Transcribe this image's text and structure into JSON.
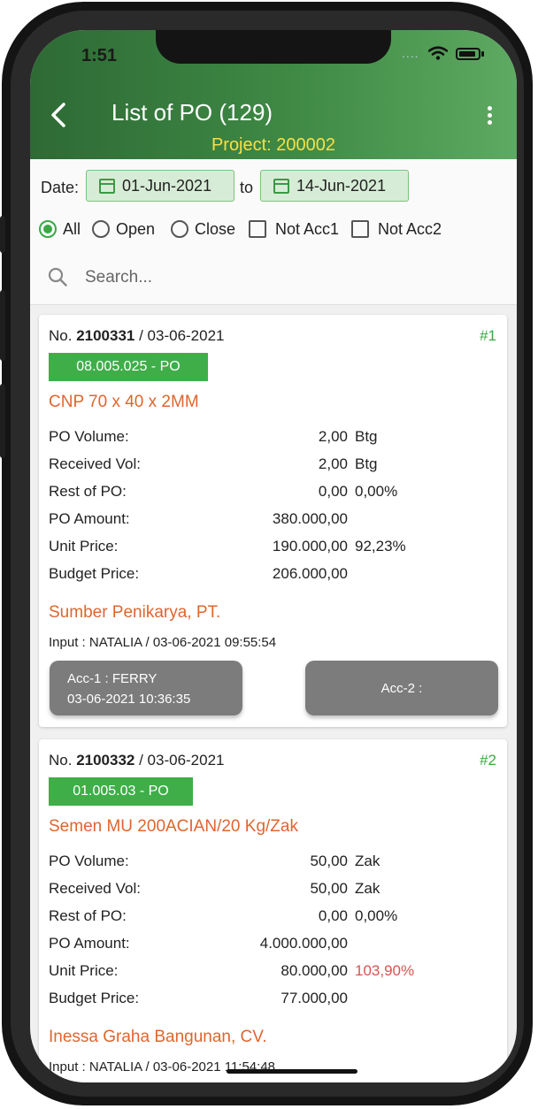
{
  "status_bar": {
    "time": "1:51",
    "dots": "...."
  },
  "header": {
    "title": "List of PO (129)",
    "subtitle": "Project: 200002"
  },
  "filters": {
    "date_label": "Date:",
    "date_from": "01-Jun-2021",
    "to_label": "to",
    "date_to": "14-Jun-2021",
    "options": [
      {
        "label": "All",
        "kind": "radio",
        "checked": true
      },
      {
        "label": "Open",
        "kind": "radio",
        "checked": false
      },
      {
        "label": "Close",
        "kind": "radio",
        "checked": false
      },
      {
        "label": "Not Acc1",
        "kind": "checkbox",
        "checked": false
      },
      {
        "label": "Not Acc2",
        "kind": "checkbox",
        "checked": false
      }
    ]
  },
  "search": {
    "placeholder": "Search..."
  },
  "cards": [
    {
      "no_prefix": "No. ",
      "po_number": "2100331",
      "po_date": " / 03-06-2021",
      "index": "#1",
      "code": "08.005.025 - PO",
      "item": "CNP 70 x 40 x 2MM",
      "rows": [
        {
          "label": "PO Volume:",
          "value": "2,00",
          "unit": "Btg"
        },
        {
          "label": "Received Vol:",
          "value": "2,00",
          "unit": "Btg"
        },
        {
          "label": "Rest of PO:",
          "value": "0,00",
          "unit": "0,00%"
        },
        {
          "label": "PO Amount:",
          "value": "380.000,00",
          "unit": ""
        },
        {
          "label": "Unit Price:",
          "value": "190.000,00",
          "unit": "92,23%"
        },
        {
          "label": "Budget Price:",
          "value": "206.000,00",
          "unit": ""
        }
      ],
      "supplier": "Sumber Penikarya, PT.",
      "input": "Input : NATALIA / 03-06-2021 09:55:54",
      "acc1_line1": "Acc-1 : FERRY",
      "acc1_line2": "03-06-2021 10:36:35",
      "acc2": "Acc-2 :"
    },
    {
      "no_prefix": "No. ",
      "po_number": "2100332",
      "po_date": " / 03-06-2021",
      "index": "#2",
      "code": "01.005.03 - PO",
      "item": "Semen MU 200ACIAN/20 Kg/Zak",
      "rows": [
        {
          "label": "PO Volume:",
          "value": "50,00",
          "unit": "Zak"
        },
        {
          "label": "Received Vol:",
          "value": "50,00",
          "unit": "Zak"
        },
        {
          "label": "Rest of PO:",
          "value": "0,00",
          "unit": "0,00%"
        },
        {
          "label": "PO Amount:",
          "value": "4.000.000,00",
          "unit": ""
        },
        {
          "label": "Unit Price:",
          "value": "80.000,00",
          "unit": "103,90%"
        },
        {
          "label": "Budget Price:",
          "value": "77.000,00",
          "unit": ""
        }
      ],
      "supplier": "Inessa Graha Bangunan, CV.",
      "input": "Input : NATALIA / 03-06-2021 11:54:48"
    }
  ],
  "colors": {
    "header_green": "#3f8a45",
    "subtitle_yellow": "#f4e04c",
    "badge_green": "#3fae49",
    "item_orange": "#e0652d",
    "over_budget_red": "#d9534f"
  }
}
